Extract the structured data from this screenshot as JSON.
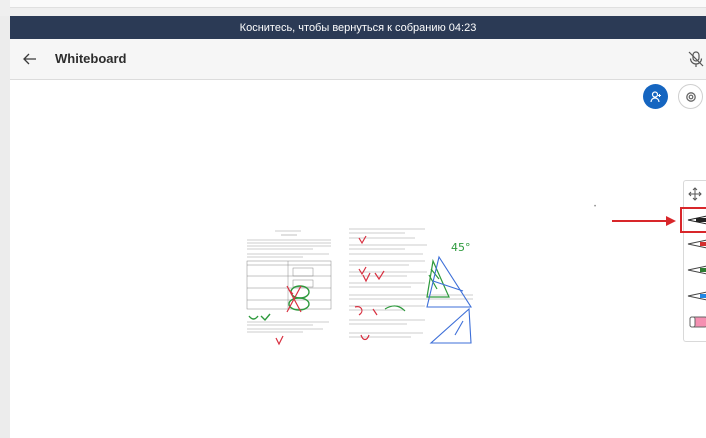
{
  "banner": {
    "text": "Коснитесь, чтобы вернуться к собранию 04:23"
  },
  "header": {
    "title": "Whiteboard"
  },
  "icons": {
    "back": "arrow-left-icon",
    "mic": "mic-off-icon",
    "avatar": "person-icon",
    "settings": "settings-icon",
    "move": "move-icon",
    "pen_black": "pen-icon",
    "pen_red": "pen-icon",
    "pen_green": "pen-icon",
    "pen_blue": "pen-icon",
    "eraser": "eraser-icon"
  },
  "toolbar": {
    "pen_colors": [
      "#222222",
      "#d32f2f",
      "#2e7d32",
      "#1e88e5"
    ],
    "eraser_color": "#f48fb1"
  },
  "annotations": {
    "highlight_color": "#d8262a"
  },
  "whiteboard": {
    "handwriting": [
      "45°"
    ]
  },
  "colors": {
    "banner_bg": "#2b3a55",
    "accent": "#1565c0"
  }
}
